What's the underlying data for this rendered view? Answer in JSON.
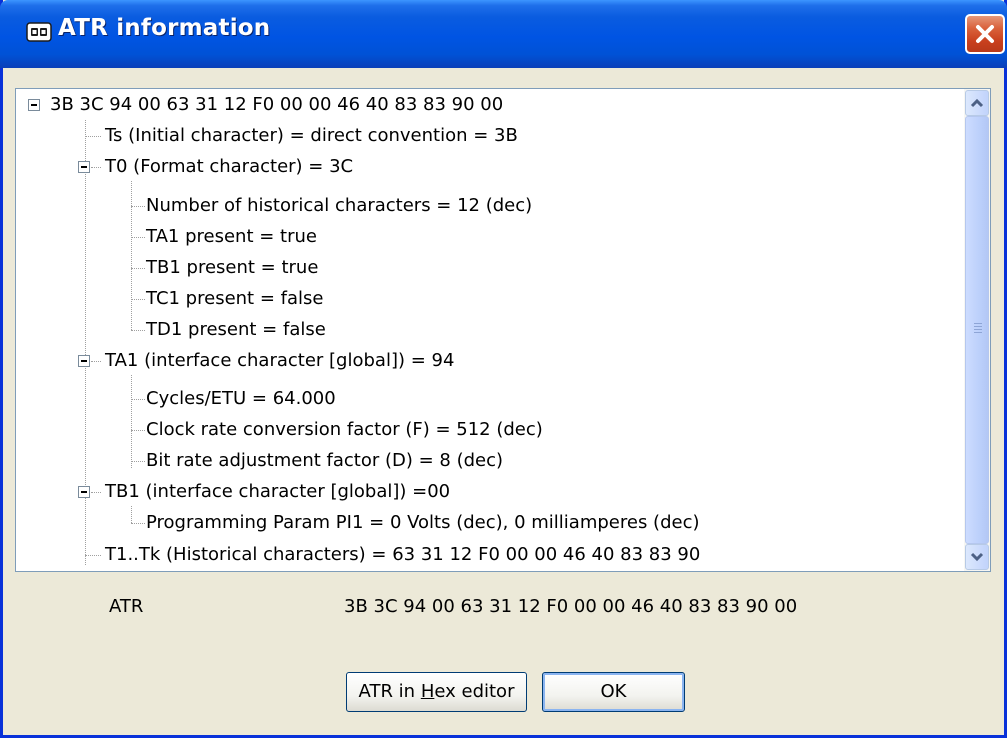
{
  "window": {
    "title": "ATR information",
    "title_icon": "smartcard-icon",
    "close_icon": "close-icon",
    "accent": "#0054e3",
    "close_color": "#d9603a"
  },
  "tree": {
    "root": "3B 3C 94 00 63 31 12 F0 00 00 46 40 83 83 90 00",
    "ts": "Ts (Initial character) = direct convention = 3B",
    "t0": "T0 (Format character) = 3C",
    "t0_children": [
      "Number of historical characters = 12 (dec)",
      "TA1 present = true",
      "TB1 present = true",
      "TC1 present = false",
      "TD1 present = false"
    ],
    "ta1": "TA1 (interface character [global]) = 94",
    "ta1_children": [
      "Cycles/ETU = 64.000",
      "Clock rate conversion factor (F) = 512 (dec)",
      "Bit rate adjustment factor (D) = 8 (dec)"
    ],
    "tb1": "TB1 (interface character [global]) =00",
    "tb1_children": [
      "Programming Param PI1 = 0 Volts (dec), 0 milliamperes (dec)"
    ],
    "tk": "T1..Tk (Historical characters) = 63 31 12 F0 00 00 46 40 83 83 90"
  },
  "atr": {
    "label": "ATR",
    "value": "3B 3C 94 00 63 31 12 F0 00 00 46 40 83 83 90 00"
  },
  "buttons": {
    "hex_pre": "ATR in ",
    "hex_accel": "H",
    "hex_post": "ex editor",
    "ok": "OK"
  }
}
